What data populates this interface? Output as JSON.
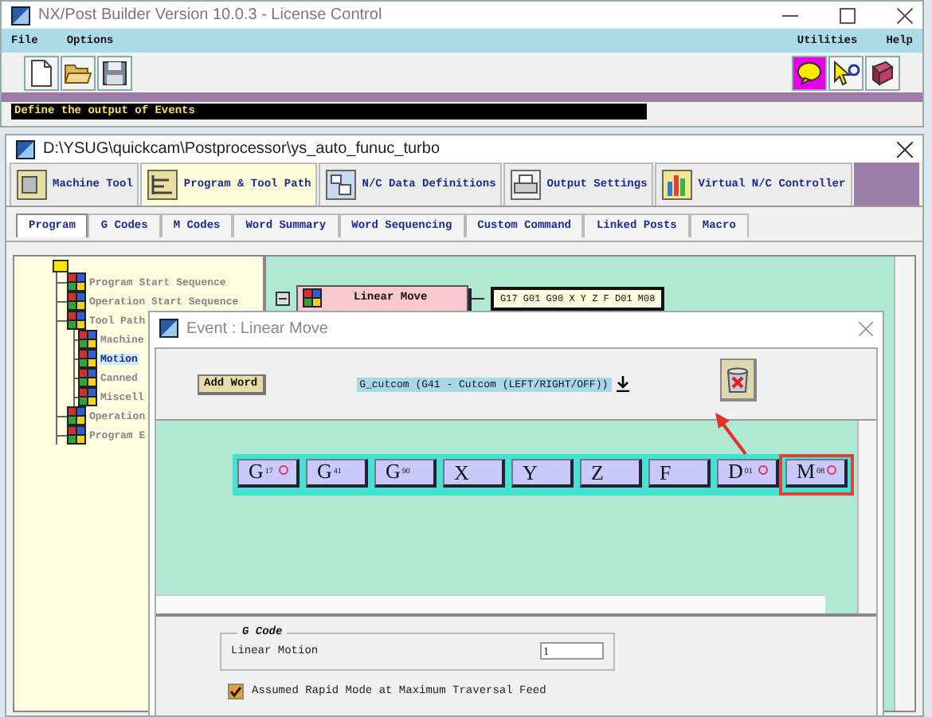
{
  "main_window": {
    "title": "NX/Post Builder Version 10.0.3 - License Control",
    "menu_left": [
      "File",
      "Options"
    ],
    "menu_right": [
      "Utilities",
      "Help"
    ],
    "status": "Define the output of Events"
  },
  "post_window": {
    "title": "D:\\YSUG\\quickcam\\Postprocessor\\ys_auto_funuc_turbo"
  },
  "tabs": [
    {
      "label": "Machine Tool",
      "selected": false
    },
    {
      "label": "Program & Tool Path",
      "selected": true
    },
    {
      "label": "N/C Data Definitions",
      "selected": false
    },
    {
      "label": "Output Settings",
      "selected": false
    },
    {
      "label": "Virtual N/C Controller",
      "selected": false
    }
  ],
  "sub_tabs": [
    {
      "label": "Program",
      "selected": true
    },
    {
      "label": "G Codes",
      "selected": false
    },
    {
      "label": "M Codes",
      "selected": false
    },
    {
      "label": "Word Summary",
      "selected": false
    },
    {
      "label": "Word Sequencing",
      "selected": false
    },
    {
      "label": "Custom Command",
      "selected": false
    },
    {
      "label": "Linked Posts",
      "selected": false
    },
    {
      "label": "Macro",
      "selected": false
    }
  ],
  "tree": [
    {
      "label": "Program Start Sequence",
      "selected": false
    },
    {
      "label": "Operation Start Sequence",
      "selected": false
    },
    {
      "label": "Tool Path",
      "selected": false,
      "children": [
        {
          "label": "Machine",
          "selected": false
        },
        {
          "label": "Motion",
          "selected": true
        },
        {
          "label": "Canned",
          "selected": false
        },
        {
          "label": "Miscell",
          "selected": false
        }
      ]
    },
    {
      "label": "Operation",
      "selected": false
    },
    {
      "label": "Program E",
      "selected": false
    }
  ],
  "event_flow": {
    "event": "Linear Move",
    "output": "G17 G01 G90 X Y Z F D01 M08"
  },
  "dialog": {
    "title": "Event : Linear Move",
    "add_word": "Add Word",
    "word_select": "G_cutcom (G41 - Cutcom (LEFT/RIGHT/OFF))",
    "words": [
      {
        "letter": "G",
        "index": "17",
        "flagged": true,
        "highlighted": false
      },
      {
        "letter": "G",
        "index": "41",
        "flagged": false,
        "highlighted": false
      },
      {
        "letter": "G",
        "index": "90",
        "flagged": false,
        "highlighted": false
      },
      {
        "letter": "X",
        "flagged": false,
        "highlighted": false
      },
      {
        "letter": "Y",
        "flagged": false,
        "highlighted": false
      },
      {
        "letter": "Z",
        "flagged": false,
        "highlighted": false
      },
      {
        "letter": "F",
        "flagged": false,
        "highlighted": false
      },
      {
        "letter": "D",
        "index": "01",
        "flagged": true,
        "highlighted": false
      },
      {
        "letter": "M",
        "index": "08",
        "flagged": true,
        "highlighted": true
      }
    ],
    "g_code": {
      "title": "G Code",
      "label": "Linear Motion",
      "value": "1"
    },
    "rapid": {
      "label": "Assumed Rapid Mode at Maximum Traversal Feed",
      "checked": true
    }
  }
}
